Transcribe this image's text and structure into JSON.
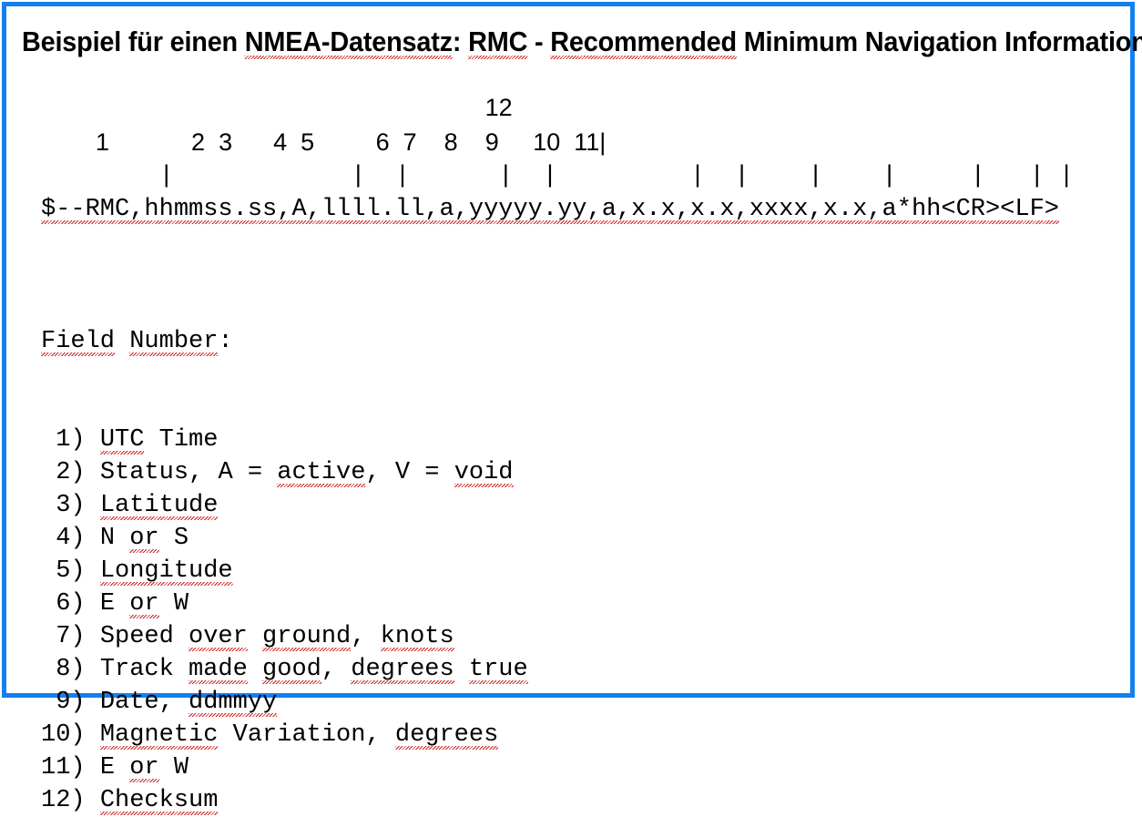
{
  "frame": {
    "border_color": "#1380ef",
    "background_color": "#ffffff"
  },
  "title": {
    "full_text": "Beispiel für einen NMEA-Datensatz: RMC - Recommended Minimum Navigation Information",
    "part_1": "Beispiel für einen ",
    "part_2_misspelled": "NMEA-Datensatz",
    "part_3": ": ",
    "part_4_misspelled": "RMC",
    "part_5": " - ",
    "part_6_misspelled": "Recommended",
    "part_7": " Minimum Navigation Information"
  },
  "diagram": {
    "numbers_top_row": "                                                                 12",
    "numbers_row": "        1            2  3      4  5         6  7    8    9     10  11|",
    "ticks_row": "        |            |  |      |  |         |  |    |    |     |   | |",
    "sentence": "$--RMC,hhmmss.ss,A,llll.ll,a,yyyyy.yy,a,x.x,x.x,xxxx,x.x,a*hh<CR><LF>",
    "field_markers": [
      "1",
      "2",
      "3",
      "4",
      "5",
      "6",
      "7",
      "8",
      "9",
      "10",
      "11",
      "12"
    ],
    "tick_glyph": "|"
  },
  "field_list": {
    "heading": "Field Number:",
    "heading_misspelled_words": [
      "Field",
      "Number"
    ],
    "items": [
      {
        "number": " 1)",
        "text": "UTC Time",
        "misspelled": [
          "UTC"
        ]
      },
      {
        "number": " 2)",
        "text": "Status, A = active, V = void",
        "misspelled": [
          "active",
          "void"
        ]
      },
      {
        "number": " 3)",
        "text": "Latitude",
        "misspelled": [
          "Latitude"
        ]
      },
      {
        "number": " 4)",
        "text": "N or S",
        "misspelled": [
          "or"
        ]
      },
      {
        "number": " 5)",
        "text": "Longitude",
        "misspelled": [
          "Longitude"
        ]
      },
      {
        "number": " 6)",
        "text": "E or W",
        "misspelled": [
          "or"
        ]
      },
      {
        "number": " 7)",
        "text": "Speed over ground, knots",
        "misspelled": [
          "over",
          "ground",
          "knots"
        ]
      },
      {
        "number": " 8)",
        "text": "Track made good, degrees true",
        "misspelled": [
          "made",
          "good",
          "degrees",
          "true"
        ]
      },
      {
        "number": " 9)",
        "text": "Date, ddmmyy",
        "misspelled": [
          "ddmmyy"
        ]
      },
      {
        "number": "10)",
        "text": "Magnetic Variation, degrees",
        "misspelled": [
          "Magnetic",
          "degrees"
        ]
      },
      {
        "number": "11)",
        "text": "E or W",
        "misspelled": [
          "or"
        ]
      },
      {
        "number": "12)",
        "text": "Checksum",
        "misspelled": [
          "Checksum"
        ]
      }
    ]
  },
  "spellcheck": {
    "underline_color": "#cc2222",
    "style": "red-wavy-underline"
  }
}
